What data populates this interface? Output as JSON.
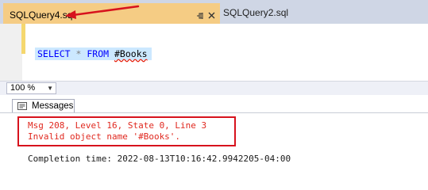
{
  "tabs": {
    "active": {
      "title": "SQLQuery4.sql"
    },
    "inactive": {
      "title": "SQLQuery2.sql"
    },
    "pin_icon": "pin-icon",
    "close_icon": "close-icon"
  },
  "editor": {
    "code": {
      "kw_select": "SELECT",
      "star": "*",
      "kw_from": "FROM",
      "table": "#Books"
    }
  },
  "zoom": {
    "value": "100 %"
  },
  "messages": {
    "tab_label": "Messages",
    "error_line1": "Msg 208, Level 16, State 0, Line 3",
    "error_line2": "Invalid object name '#Books'.",
    "completion": "Completion time: 2022-08-13T10:16:42.9942205-04:00"
  },
  "colors": {
    "active_tab": "#f5cc84",
    "tab_strip": "#cfd6e5",
    "error_text": "#e0281f",
    "annotation": "#d7121d",
    "keyword": "#0000ff",
    "selection": "#cce8ff"
  }
}
